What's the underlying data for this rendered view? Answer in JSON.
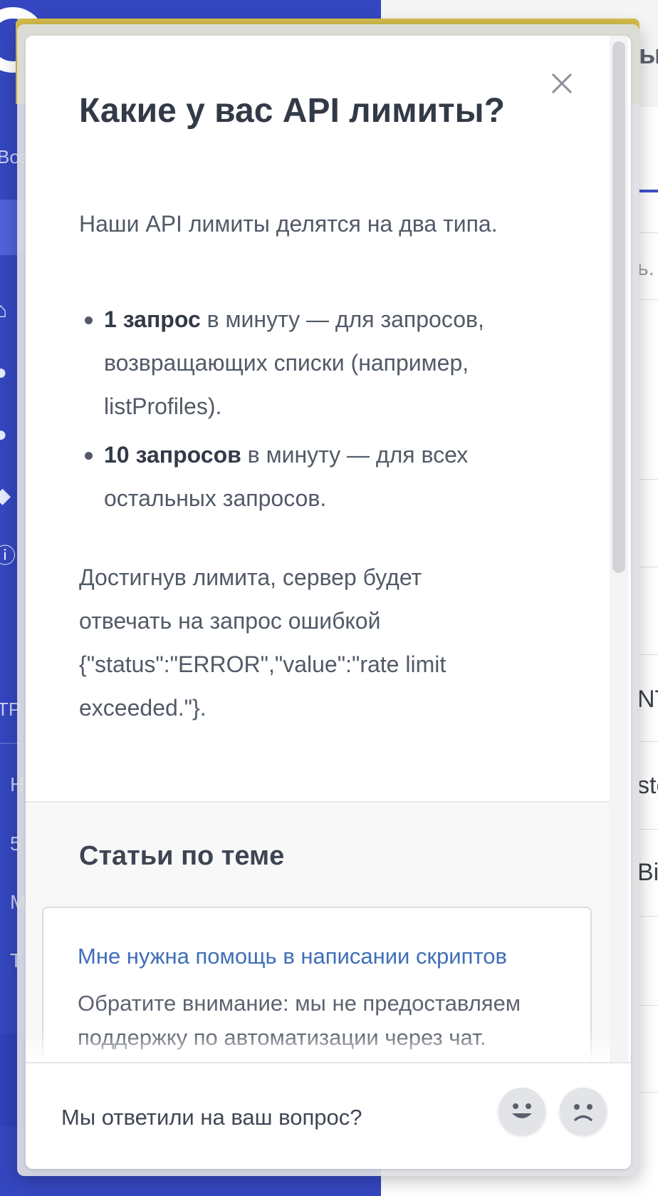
{
  "article": {
    "title": "Какие у вас API лимиты?",
    "intro": "Наши API лимиты делятся на два типа.",
    "limits": [
      {
        "bold": "1 запрос",
        "text": " в минуту — для запросов, возвращающих списки (например, listProfiles)."
      },
      {
        "bold": "10 запросов",
        "text": " в минуту — для всех остальных запросов."
      }
    ],
    "outro": "Достигнув лимита, сервер будет отвечать на запрос ошибкой {\"status\":\"ERROR\",\"value\":\"rate limit exceeded.\"}."
  },
  "related": {
    "heading": "Статьи по теме",
    "card": {
      "title": "Мне нужна помощь в написании скриптов",
      "desc": "Обратите внимание: мы не предоставляем поддержку по автоматизации через чат."
    }
  },
  "feedback": {
    "question": "Мы ответили на ваш вопрос?",
    "positive_icon": "smiley-happy-icon",
    "negative_icon": "smiley-sad-icon"
  },
  "background": {
    "sidebar_partial_texts": [
      "Воз",
      "ТР"
    ],
    "sidebar_partial_letters": [
      "Н",
      "5",
      "М",
      "Т"
    ],
    "main_partial_title": "ы",
    "main_partial_texts": [
      "ь.",
      "NT",
      "ste",
      "Bi"
    ]
  },
  "colors": {
    "sidebar": "#3447c0",
    "banner": "#d6bf4e",
    "link": "#3f6fb8",
    "text": "#525a67",
    "heading": "#333a47"
  }
}
